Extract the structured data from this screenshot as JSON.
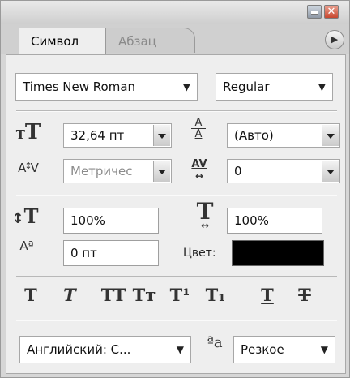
{
  "window": {
    "minimize_icon": "minimize-icon",
    "close_icon": "close-icon",
    "close_glyph": "✕"
  },
  "tabs": [
    {
      "label": "Символ",
      "active": true
    },
    {
      "label": "Абзац",
      "active": false
    }
  ],
  "panel_menu": {
    "glyph": "▶",
    "icon": "panel-menu-icon"
  },
  "font": {
    "family": "Times New Roman",
    "style": "Regular"
  },
  "size": {
    "value": "32,64 пт",
    "icon": "font-size-icon"
  },
  "leading": {
    "value": "(Авто)",
    "icon": "leading-icon",
    "icon_top": "A",
    "icon_bottom": "A"
  },
  "kerning": {
    "value": "Метричес",
    "icon": "kerning-icon"
  },
  "tracking": {
    "value": "0",
    "icon": "tracking-icon",
    "icon_text": "AV"
  },
  "vertical_scale": {
    "value": "100%",
    "icon": "vertical-scale-icon"
  },
  "horizontal_scale": {
    "value": "100%",
    "icon": "horizontal-scale-icon"
  },
  "baseline_shift": {
    "value": "0 пт",
    "icon": "baseline-shift-icon",
    "icon_text": "Aª"
  },
  "color": {
    "label": "Цвет:",
    "swatch": "#000000"
  },
  "style_buttons": [
    {
      "name": "faux-bold",
      "glyph": "T"
    },
    {
      "name": "faux-italic",
      "glyph": "T"
    },
    {
      "name": "all-caps",
      "glyph": "TT"
    },
    {
      "name": "small-caps",
      "glyph": "Tт"
    },
    {
      "name": "superscript",
      "glyph": "T¹"
    },
    {
      "name": "subscript",
      "glyph": "T₁"
    },
    {
      "name": "underline",
      "glyph": "T"
    },
    {
      "name": "strikethrough",
      "glyph": "T"
    }
  ],
  "language": {
    "value": "Английский: С..."
  },
  "antialias": {
    "icon_text": "ªa",
    "value": "Резкое"
  }
}
